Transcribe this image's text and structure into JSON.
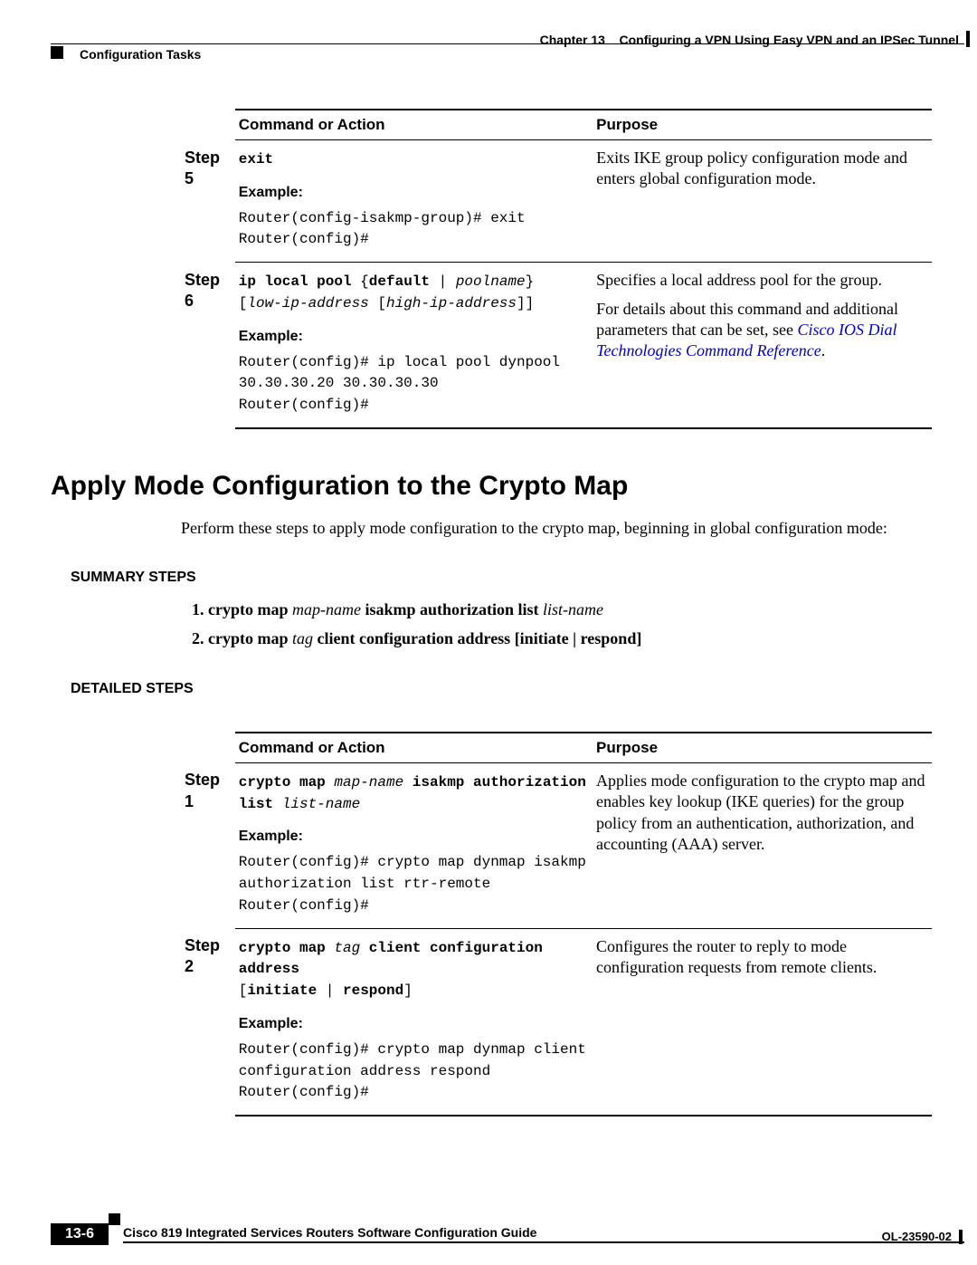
{
  "header": {
    "chapter_label": "Chapter 13",
    "chapter_title": "Configuring a VPN Using Easy VPN and an IPSec Tunnel",
    "section": "Configuration Tasks"
  },
  "table1": {
    "col1_header": "Command or Action",
    "col2_header": "Purpose",
    "step5_label": "Step 5",
    "step5_cmd": "exit",
    "step5_example_label": "Example:",
    "step5_example_code": "Router(config-isakmp-group)# exit\nRouter(config)#",
    "step5_purpose": "Exits IKE group policy configuration mode and enters global configuration mode.",
    "step6_label": "Step 6",
    "step6_cmd_b1": "ip local pool",
    "step6_cmd_p1": " {",
    "step6_cmd_b2": "default",
    "step6_cmd_p2": " | ",
    "step6_cmd_i1": "poolname",
    "step6_cmd_p3": "}",
    "step6_cmd_line2_p1": "[",
    "step6_cmd_line2_i1": "low-ip-address",
    "step6_cmd_line2_p2": " [",
    "step6_cmd_line2_i2": "high-ip-address",
    "step6_cmd_line2_p3": "]]",
    "step6_example_label": "Example:",
    "step6_example_code": "Router(config)# ip local pool dynpool 30.30.30.20 30.30.30.30\nRouter(config)#",
    "step6_purpose_1": "Specifies a local address pool for the group.",
    "step6_purpose_2a": "For details about this command and additional parameters that can be set, see ",
    "step6_purpose_link": "Cisco IOS Dial Technologies Command Reference",
    "step6_purpose_2b": "."
  },
  "section2": {
    "heading": "Apply Mode Configuration to the Crypto Map",
    "intro": "Perform these steps to apply mode configuration to the crypto map, beginning in global configuration mode:",
    "summary_heading": "SUMMARY STEPS",
    "sum1_b1": "crypto map ",
    "sum1_i1": "map-name ",
    "sum1_b2": "isakmp authorization list ",
    "sum1_i2": "list-name",
    "sum2_b1": "crypto map ",
    "sum2_i1": "tag ",
    "sum2_b2": "client configuration address ",
    "sum2_b3": "[initiate | respond]",
    "detailed_heading": "DETAILED STEPS"
  },
  "table2": {
    "col1_header": "Command or Action",
    "col2_header": "Purpose",
    "step1_label": "Step 1",
    "s1_b1": "crypto map ",
    "s1_i1": "map-name",
    "s1_b2": " isakmp authorization list ",
    "s1_i2": "list-name",
    "s1_example_label": "Example:",
    "s1_example_code": "Router(config)# crypto map dynmap isakmp authorization list rtr-remote\nRouter(config)#",
    "s1_purpose": "Applies mode configuration to the crypto map and enables key lookup (IKE queries) for the group policy from an authentication, authorization, and accounting (AAA) server.",
    "step2_label": "Step 2",
    "s2_b1": "crypto map ",
    "s2_i1": "tag",
    "s2_b2": " client configuration address",
    "s2_line2_p1": "[",
    "s2_line2_b1": "initiate",
    "s2_line2_p2": " | ",
    "s2_line2_b2": "respond",
    "s2_line2_p3": "]",
    "s2_example_label": "Example:",
    "s2_example_code": "Router(config)# crypto map dynmap client configuration address respond\nRouter(config)#",
    "s2_purpose": "Configures the router to reply to mode configuration requests from remote clients."
  },
  "footer": {
    "doc_title": "Cisco 819 Integrated Services Routers Software Configuration Guide",
    "page_num": "13-6",
    "doc_id": "OL-23590-02"
  }
}
